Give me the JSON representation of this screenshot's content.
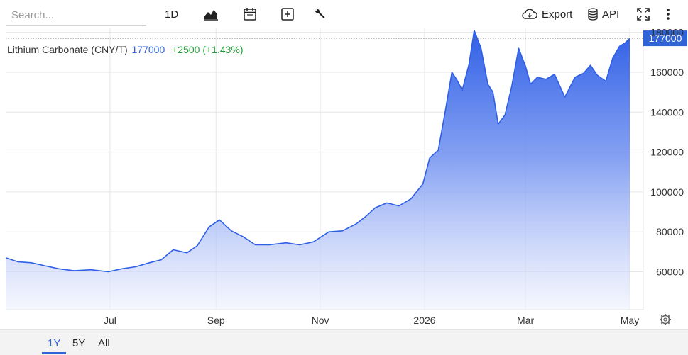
{
  "toolbar": {
    "search_placeholder": "Search...",
    "interval_label": "1D",
    "export_label": "Export",
    "api_label": "API",
    "icons": [
      "chart-type-icon",
      "calendar-icon",
      "compare-plus-icon",
      "wrench-icon",
      "cloud-download-icon",
      "database-icon",
      "fullscreen-icon",
      "more-vertical-icon"
    ]
  },
  "header": {
    "name": "Lithium Carbonate (CNY/T)",
    "price": "177000",
    "change": "+2500 (+1.43%)"
  },
  "ranges": [
    "1Y",
    "5Y",
    "All"
  ],
  "active_range": "1Y",
  "chart_data": {
    "type": "area",
    "title": "Lithium Carbonate (CNY/T)",
    "xlabel": "",
    "ylabel": "",
    "x_start": "2025-05-01",
    "x_end": "2026-05-01",
    "last_value_label": "177000",
    "y_ticks": [
      60000,
      80000,
      100000,
      120000,
      140000,
      160000,
      180000
    ],
    "y_tick_labels": [
      "60000",
      "80000",
      "100000",
      "120000",
      "140000",
      "160000",
      "180000"
    ],
    "x_tick_labels": [
      "Jul",
      "Sep",
      "Nov",
      "2026",
      "Mar",
      "May"
    ],
    "x_ticks": [
      "2025-07-01",
      "2025-09-01",
      "2025-11-01",
      "2026-01-01",
      "2026-03-01",
      "2026-05-01"
    ],
    "ylim": [
      41000,
      182000
    ],
    "points": [
      [
        "2025-05-01",
        67000
      ],
      [
        "2025-05-08",
        65000
      ],
      [
        "2025-05-16",
        64500
      ],
      [
        "2025-05-24",
        63000
      ],
      [
        "2025-06-01",
        61500
      ],
      [
        "2025-06-10",
        60500
      ],
      [
        "2025-06-20",
        61000
      ],
      [
        "2025-06-30",
        60000
      ],
      [
        "2025-07-08",
        61500
      ],
      [
        "2025-07-16",
        62500
      ],
      [
        "2025-07-24",
        64500
      ],
      [
        "2025-07-31",
        66000
      ],
      [
        "2025-08-07",
        71000
      ],
      [
        "2025-08-15",
        69500
      ],
      [
        "2025-08-21",
        73000
      ],
      [
        "2025-08-28",
        82500
      ],
      [
        "2025-09-03",
        86000
      ],
      [
        "2025-09-10",
        80500
      ],
      [
        "2025-09-17",
        77500
      ],
      [
        "2025-09-24",
        73500
      ],
      [
        "2025-10-02",
        73500
      ],
      [
        "2025-10-12",
        74500
      ],
      [
        "2025-10-20",
        73500
      ],
      [
        "2025-10-28",
        75000
      ],
      [
        "2025-11-06",
        80000
      ],
      [
        "2025-11-14",
        80500
      ],
      [
        "2025-11-22",
        84000
      ],
      [
        "2025-11-28",
        88000
      ],
      [
        "2025-12-03",
        92000
      ],
      [
        "2025-12-10",
        94500
      ],
      [
        "2025-12-17",
        93000
      ],
      [
        "2025-12-24",
        96500
      ],
      [
        "2025-12-31",
        104000
      ],
      [
        "2026-01-04",
        117000
      ],
      [
        "2026-01-09",
        121000
      ],
      [
        "2026-01-13",
        140000
      ],
      [
        "2026-01-17",
        160000
      ],
      [
        "2026-01-20",
        156000
      ],
      [
        "2026-01-23",
        151000
      ],
      [
        "2026-01-27",
        164000
      ],
      [
        "2026-01-30",
        181000
      ],
      [
        "2026-02-03",
        172000
      ],
      [
        "2026-02-07",
        154000
      ],
      [
        "2026-02-10",
        150000
      ],
      [
        "2026-02-13",
        134000
      ],
      [
        "2026-02-17",
        138500
      ],
      [
        "2026-02-21",
        153000
      ],
      [
        "2026-02-25",
        172000
      ],
      [
        "2026-03-01",
        163000
      ],
      [
        "2026-03-04",
        154000
      ],
      [
        "2026-03-08",
        157500
      ],
      [
        "2026-03-13",
        156500
      ],
      [
        "2026-03-18",
        159000
      ],
      [
        "2026-03-24",
        147500
      ],
      [
        "2026-03-30",
        157500
      ],
      [
        "2026-04-04",
        159500
      ],
      [
        "2026-04-08",
        163500
      ],
      [
        "2026-04-12",
        158500
      ],
      [
        "2026-04-17",
        155500
      ],
      [
        "2026-04-21",
        167000
      ],
      [
        "2026-04-25",
        173000
      ],
      [
        "2026-04-28",
        174500
      ],
      [
        "2026-05-01",
        177000
      ]
    ]
  }
}
